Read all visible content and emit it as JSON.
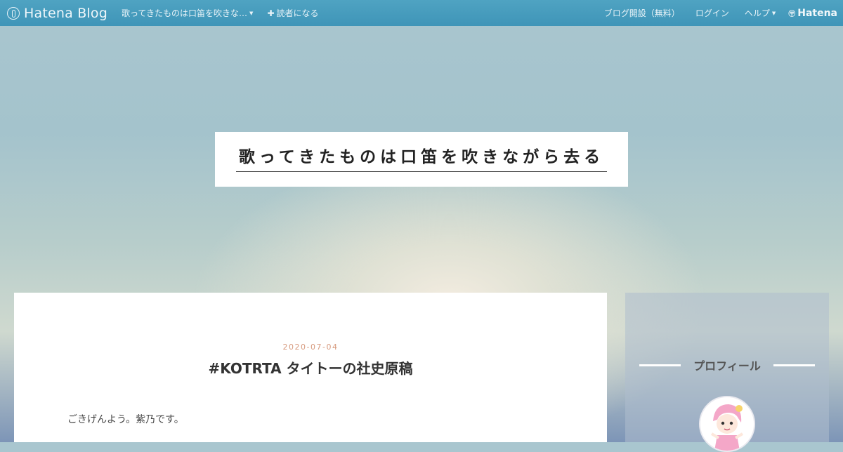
{
  "topbar": {
    "brand": "Hatena Blog",
    "blog_menu": "歌ってきたものは口笛を吹きな…",
    "subscribe": "読者になる",
    "open_blog": "ブログ開設（無料）",
    "login": "ログイン",
    "help": "ヘルプ",
    "hatena": "Hatena"
  },
  "header": {
    "blog_title": "歌ってきたものは口笛を吹きながら去る"
  },
  "post": {
    "date": "2020-07-04",
    "title": "#KOTRTA タイトーの社史原稿",
    "body_first_line": "ごきげんよう。紫乃です。"
  },
  "sidebar": {
    "profile_heading": "プロフィール"
  },
  "colors": {
    "topbar": "#4fa3c2",
    "date_accent": "#d79a7e"
  }
}
